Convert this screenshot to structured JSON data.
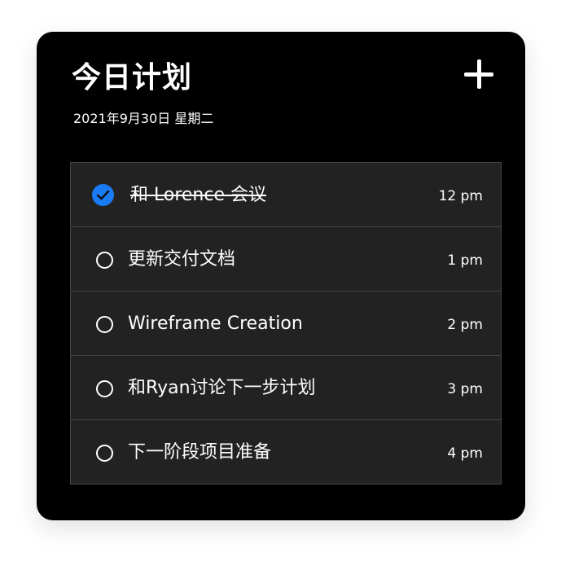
{
  "header": {
    "title": "今日计划",
    "date": "2021年9月30日 星期二",
    "add_icon": "plus-icon"
  },
  "tasks": [
    {
      "label": "和 Lorence 会议",
      "time": "12 pm",
      "done": true
    },
    {
      "label": "更新交付文档",
      "time": "1 pm",
      "done": false
    },
    {
      "label": "Wireframe Creation",
      "time": "2 pm",
      "done": false
    },
    {
      "label": "和Ryan讨论下一步计划",
      "time": "3 pm",
      "done": false
    },
    {
      "label": "下一阶段项目准备",
      "time": "4 pm",
      "done": false
    }
  ],
  "colors": {
    "card_background": "#000000",
    "row_background": "#222222",
    "row_border": "#454545",
    "accent_check": "#1a7cf5",
    "text": "#ffffff"
  }
}
